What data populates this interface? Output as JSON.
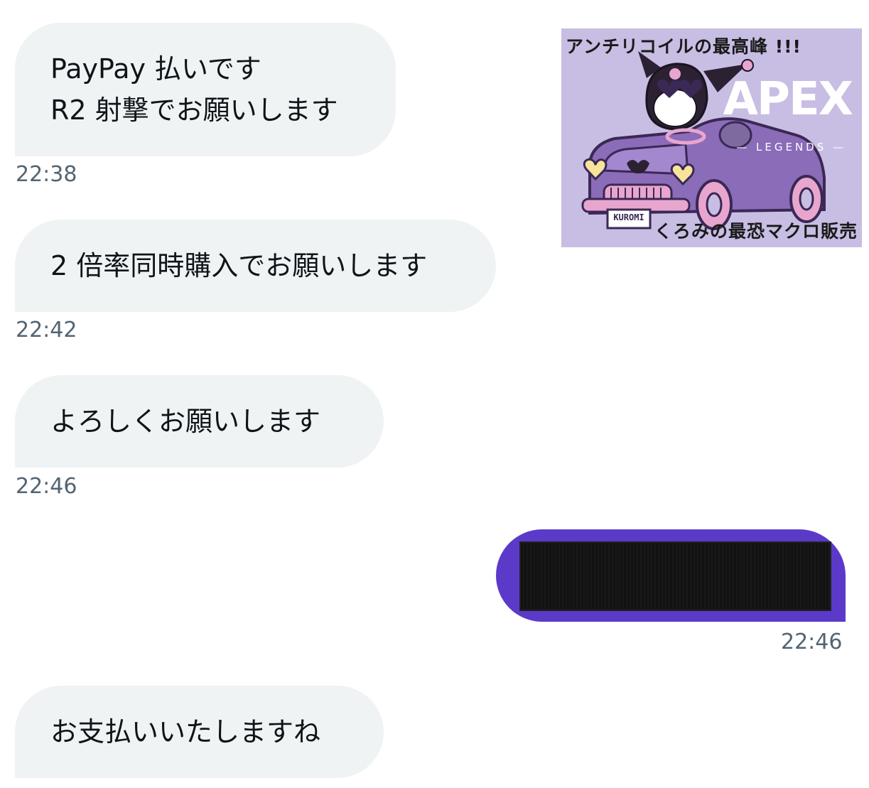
{
  "messages": [
    {
      "lines": [
        "PayPay 払いです",
        "R2 射撃でお願いします"
      ],
      "time": "22:38"
    },
    {
      "lines": [
        "2 倍率同時購入でお願いします"
      ],
      "time": "22:42"
    },
    {
      "lines": [
        "よろしくお願いします"
      ],
      "time": "22:46"
    },
    {
      "time": "22:46"
    },
    {
      "lines": [
        "お支払いいたしますね"
      ]
    }
  ],
  "ad_image": {
    "top_text": "アンチリコイルの最高峰 !!!",
    "logo": "APEX",
    "logo_sub": "— LEGENDS —",
    "plate": "KUROMI",
    "bottom_text": "くろみの最恐マクロ販売"
  },
  "colors": {
    "incoming_bubble": "#eff3f4",
    "outgoing_bubble": "#5b3ac9",
    "timestamp": "#536471",
    "ad_background": "#c8bde3"
  }
}
